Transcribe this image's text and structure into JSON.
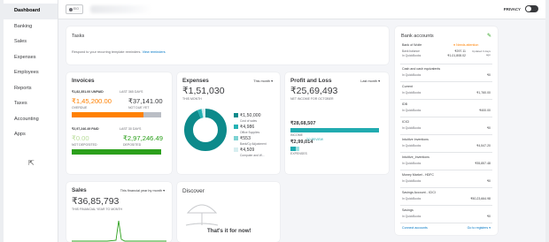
{
  "sidebar": {
    "items": [
      {
        "label": "Dashboard"
      },
      {
        "label": "Banking"
      },
      {
        "label": "Sales"
      },
      {
        "label": "Expenses"
      },
      {
        "label": "Employees"
      },
      {
        "label": "Reports"
      },
      {
        "label": "Taxes"
      },
      {
        "label": "Accounting"
      },
      {
        "label": "Apps"
      }
    ]
  },
  "topbar": {
    "company_logo_text": "EIO",
    "privacy_label": "PRIVACY"
  },
  "tasks": {
    "title": "Tasks",
    "message": "Respond to your recurring template reminders.",
    "link": "View reminders"
  },
  "invoices": {
    "title": "Invoices",
    "unpaid_line": "₹1,82,351.00 UNPAID",
    "unpaid_period": "LAST 365 DAYS",
    "overdue_amount": "₹1,45,200.00",
    "overdue_label": "OVERDUE",
    "not_due_amount": "₹37,141.00",
    "not_due_label": "NOT DUE YET",
    "overdue_fraction": 0.8,
    "paid_line": "₹2,97,246.49 PAID",
    "paid_period": "LAST 30 DAYS",
    "not_deposited_amount": "₹0.00",
    "not_deposited_label": "NOT DEPOSITED",
    "deposited_amount": "₹2,97,246.49",
    "deposited_label": "DEPOSITED",
    "deposited_fraction": 1.0,
    "colors": {
      "overdue": "#ff8000",
      "not_due": "#babec5",
      "not_deposited": "#c4e4a8",
      "deposited": "#2ca01c"
    }
  },
  "expenses": {
    "title": "Expenses",
    "period": "This month",
    "total": "₹1,51,030",
    "total_label": "THIS MONTH",
    "legend": [
      {
        "amount": "₹1,50,000",
        "label": "Cost of sales",
        "color": "#0d8a8b",
        "value": 150000
      },
      {
        "amount": "₹4,986",
        "label": "Office Supplies",
        "color": "#25b2b4",
        "value": 4986
      },
      {
        "amount": "₹553",
        "label": "Bank/Cy Adjustment",
        "color": "#7dd3d3",
        "value": 553
      },
      {
        "amount": "₹4,509",
        "label": "Computer and W...",
        "color": "#d7eef0",
        "value": 4509
      }
    ]
  },
  "profit_loss": {
    "title": "Profit and Loss",
    "period": "Last month",
    "net_income": "₹25,69,493",
    "net_income_label": "NET INCOME FOR OCTOBER",
    "income_amount": "₹28,68,507",
    "income_label": "INCOME",
    "expenses_amount": "₹2,99,014",
    "expenses_label": "EXPENSES",
    "to_review": "TO REVIEW",
    "income_fraction": 1.0,
    "expenses_fraction": 0.1,
    "colors": {
      "income": "#21abb0",
      "expenses": "#21abb0",
      "expenses_review": "#9fe1e3"
    }
  },
  "bank_accounts": {
    "title": "Bank accounts",
    "rows": [
      {
        "name": "Bank of Wolfe",
        "badge": "Needs attention",
        "sub": "Bank balance",
        "sub2": "In QuickBooks",
        "value": "₹297.11",
        "value2": "₹1,01,808.02",
        "updated": "Updated 3 days ago"
      },
      {
        "name": "Cash and cash equivalents",
        "sub": "In QuickBooks",
        "value": "₹0"
      },
      {
        "name": "Current",
        "sub": "In QuickBooks",
        "value": "₹1,760.00"
      },
      {
        "name": "IDB",
        "sub": "In QuickBooks",
        "value": "₹400.00"
      },
      {
        "name": "ICICI",
        "sub": "In QuickBooks",
        "value": "₹0"
      },
      {
        "name": "IntuitIve Inventions",
        "sub": "In QuickBooks",
        "value": "₹4,547.20"
      },
      {
        "name": "IntuitIve_Inventions",
        "sub": "In QuickBooks",
        "value": "₹35,857.48"
      },
      {
        "name": "Money Market - HDFC",
        "sub": "In QuickBooks",
        "value": "₹0"
      },
      {
        "name": "Savings Account - ICICI",
        "sub": "In QuickBooks",
        "value": "₹50,23,664.98"
      },
      {
        "name": "Savings",
        "sub": "In QuickBooks",
        "value": "₹0"
      }
    ],
    "connect_label": "Connect accounts",
    "register_label": "Go to registers"
  },
  "sales": {
    "title": "Sales",
    "period": "This financial year by month",
    "total": "₹36,85,793",
    "total_label": "THIS FINANCIAL YEAR TO MONTH"
  },
  "discover": {
    "title": "Discover",
    "message": "That's it for now!"
  }
}
